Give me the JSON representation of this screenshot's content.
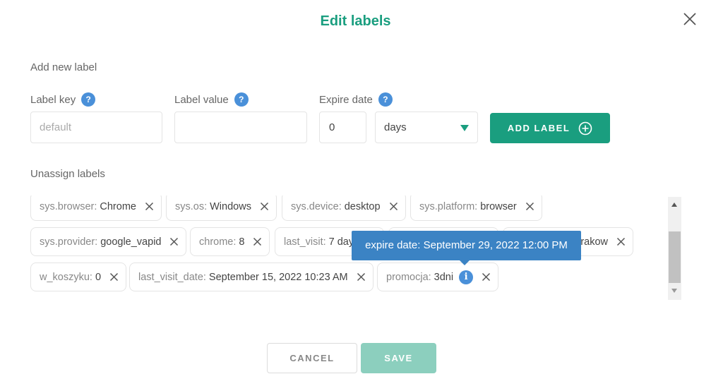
{
  "dialog": {
    "title": "Edit labels"
  },
  "add_section": {
    "title": "Add new label",
    "label_key": {
      "label": "Label key",
      "placeholder": "default",
      "value": ""
    },
    "label_value": {
      "label": "Label value",
      "placeholder": "",
      "value": ""
    },
    "expire_date": {
      "label": "Expire date",
      "amount": "0",
      "unit_selected": "days"
    },
    "help_glyph": "?",
    "add_button_label": "ADD LABEL"
  },
  "unassign_section": {
    "title": "Unassign labels",
    "labels": [
      {
        "key": "sys.browser:",
        "value": "Chrome"
      },
      {
        "key": "sys.os:",
        "value": "Windows"
      },
      {
        "key": "sys.device:",
        "value": "desktop"
      },
      {
        "key": "sys.platform:",
        "value": "browser"
      },
      {
        "key": "sys.provider:",
        "value": "google_vapid"
      },
      {
        "key": "chrome:",
        "value": "8"
      },
      {
        "key": "last_visit:",
        "value": "7 days"
      },
      {
        "key": "",
        "value": ""
      },
      {
        "key": "",
        "value": "krakow"
      },
      {
        "key": "w_koszyku:",
        "value": "0"
      },
      {
        "key": "last_visit_date:",
        "value": "September 15, 2022 10:23 AM"
      },
      {
        "key": "promocja:",
        "value": "3dni",
        "has_info": true
      }
    ],
    "info_glyph": "i",
    "tooltip": "expire date: September 29, 2022 12:00 PM"
  },
  "footer": {
    "cancel_label": "CANCEL",
    "save_label": "SAVE"
  },
  "colors": {
    "accent": "#1a9e7f",
    "accent_disabled": "#8ccfbe",
    "info_blue": "#4a90d9",
    "tooltip_bg": "#3b83c4"
  }
}
